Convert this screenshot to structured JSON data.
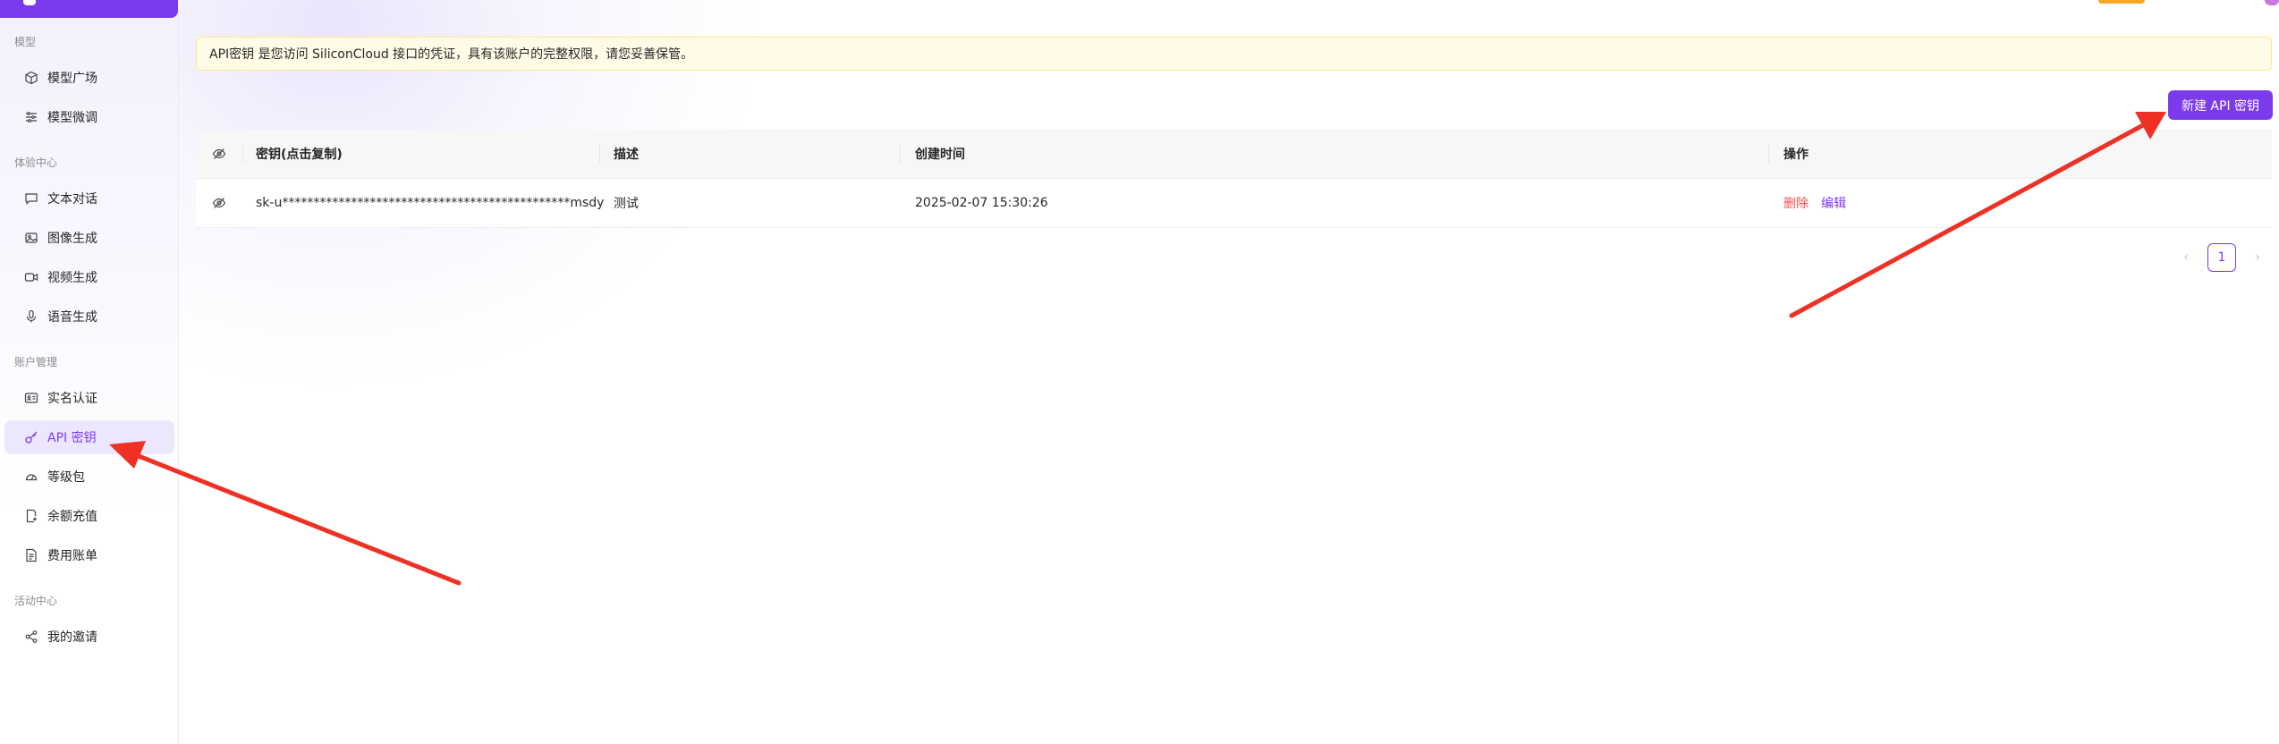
{
  "sidebar": {
    "sections": [
      {
        "title": "模型"
      },
      {
        "title": "体验中心"
      },
      {
        "title": "账户管理"
      },
      {
        "title": "活动中心"
      }
    ],
    "items": [
      {
        "label": "模型广场",
        "icon": "cube-icon"
      },
      {
        "label": "模型微调",
        "icon": "sliders-icon"
      },
      {
        "label": "文本对话",
        "icon": "chat-bubble-icon"
      },
      {
        "label": "图像生成",
        "icon": "image-icon"
      },
      {
        "label": "视频生成",
        "icon": "video-camera-icon"
      },
      {
        "label": "语音生成",
        "icon": "microphone-icon"
      },
      {
        "label": "实名认证",
        "icon": "id-card-icon"
      },
      {
        "label": "API 密钥",
        "icon": "key-icon",
        "active": true
      },
      {
        "label": "等级包",
        "icon": "gauge-icon"
      },
      {
        "label": "余额充值",
        "icon": "recharge-icon"
      },
      {
        "label": "费用账单",
        "icon": "bill-icon"
      },
      {
        "label": "我的邀请",
        "icon": "share-icon"
      }
    ]
  },
  "notice": {
    "text": "API密钥 是您访问 SiliconCloud 接口的凭证，具有该账户的完整权限，请您妥善保管。"
  },
  "actions": {
    "new_key_label": "新建 API 密钥"
  },
  "table": {
    "columns": [
      "密钥(点击复制)",
      "描述",
      "创建时间",
      "操作"
    ],
    "rows": [
      {
        "key": "sk-u**********************************************msdy",
        "description": "测试",
        "created": "2025-02-07 15:30:26",
        "delete_label": "删除",
        "edit_label": "编辑"
      }
    ]
  },
  "pagination": {
    "prev": "‹",
    "current": "1",
    "next": "›"
  },
  "colors": {
    "accent": "#7c3aed",
    "danger": "#ff4d4f",
    "notice_bg": "#fffbe6",
    "arrow": "#ee3124"
  }
}
